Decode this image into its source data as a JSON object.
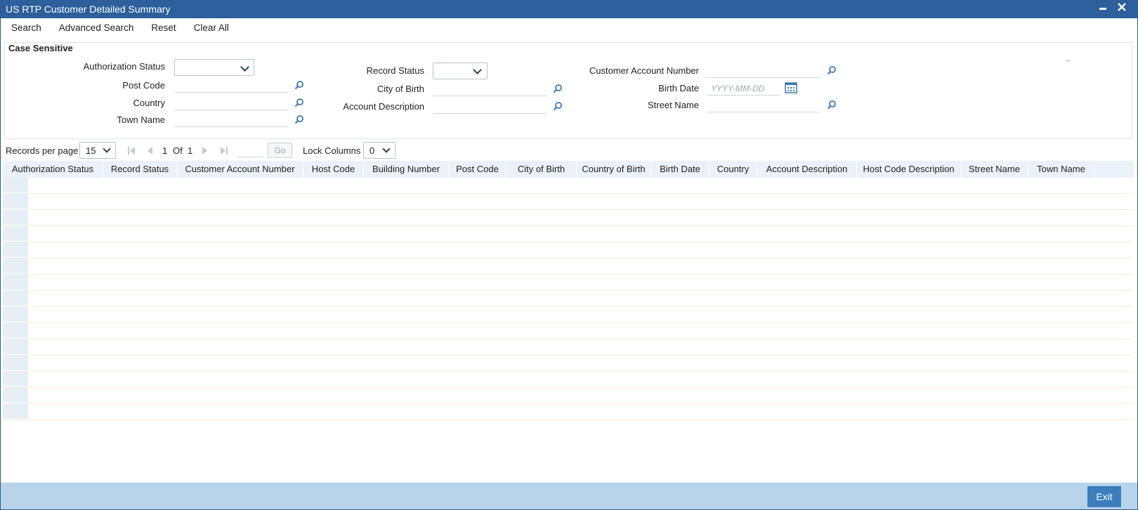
{
  "window": {
    "title": "US RTP Customer Detailed Summary",
    "minimize_glyph": "▬",
    "close_glyph": "✕"
  },
  "toolbar": {
    "search": "Search",
    "advanced_search": "Advanced Search",
    "reset": "Reset",
    "clear_all": "Clear All"
  },
  "criteria": {
    "title": "Case Sensitive",
    "authorization_status": {
      "label": "Authorization Status",
      "value": ""
    },
    "post_code": {
      "label": "Post Code",
      "value": ""
    },
    "country": {
      "label": "Country",
      "value": ""
    },
    "town_name": {
      "label": "Town Name",
      "value": ""
    },
    "record_status": {
      "label": "Record Status",
      "value": ""
    },
    "city_of_birth": {
      "label": "City of Birth",
      "value": ""
    },
    "account_description": {
      "label": "Account Description",
      "value": ""
    },
    "customer_account_number": {
      "label": "Customer Account Number",
      "value": ""
    },
    "birth_date": {
      "label": "Birth Date",
      "placeholder": "YYYY-MM-DD"
    },
    "street_name": {
      "label": "Street Name",
      "value": ""
    }
  },
  "pager": {
    "records_per_page_label": "Records per page",
    "records_per_page": "15",
    "current_page": "1",
    "of_label": "Of",
    "total_pages": "1",
    "go_label": "Go",
    "lock_columns_label": "Lock Columns",
    "lock_columns": "0"
  },
  "grid": {
    "columns": [
      "Authorization Status",
      "Record Status",
      "Customer Account Number",
      "Host Code",
      "Building Number",
      "Post Code",
      "City of Birth",
      "Country of Birth",
      "Birth Date",
      "Country",
      "Account Description",
      "Host Code Description",
      "Street Name",
      "Town Name"
    ],
    "empty_rows": 15
  },
  "footer": {
    "exit": "Exit"
  },
  "colors": {
    "titlebar": "#2c5f9b",
    "footer": "#b9d3ea",
    "exit_button": "#3c7dbd",
    "header_bg": "#eaf1f8"
  }
}
